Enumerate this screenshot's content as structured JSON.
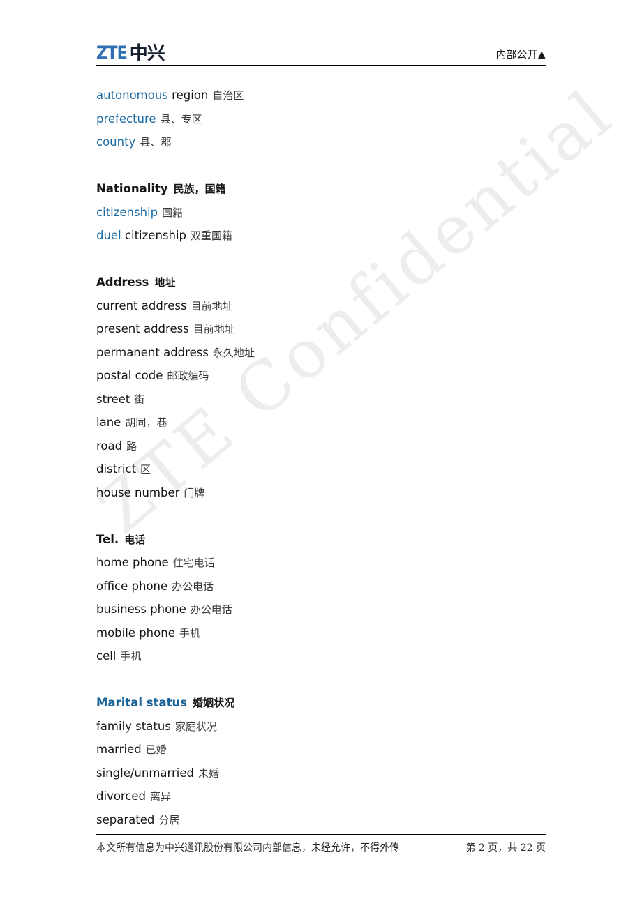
{
  "header": {
    "logo_en": "ZTE",
    "logo_cn": "中兴",
    "classification": "内部公开▲"
  },
  "watermark": {
    "text": "ZTE Confidential"
  },
  "content": {
    "blocks": [
      {
        "type": "entries",
        "items": [
          {
            "en_blue": "autonomous",
            "en_black": " region",
            "cn": "自治区"
          },
          {
            "en_blue": "prefecture",
            "en_black": "",
            "cn": "县、专区"
          },
          {
            "en_blue": "county",
            "en_black": "",
            "cn": "县、郡"
          }
        ]
      },
      {
        "type": "heading",
        "style": "black",
        "en": "Nationality",
        "cn": "民族，国籍"
      },
      {
        "type": "entries",
        "items": [
          {
            "en_blue": "citizenship",
            "en_black": "",
            "cn": "国籍"
          },
          {
            "en_blue": "duel",
            "en_black": " citizenship",
            "cn": "双重国籍"
          }
        ]
      },
      {
        "type": "heading",
        "style": "black",
        "en": "Address",
        "cn": "地址"
      },
      {
        "type": "entries",
        "items": [
          {
            "en_blue": "",
            "en_black": "current address",
            "cn": "目前地址"
          },
          {
            "en_blue": "",
            "en_black": "present address",
            "cn": "目前地址"
          },
          {
            "en_blue": "",
            "en_black": "permanent address",
            "cn": "永久地址"
          },
          {
            "en_blue": "",
            "en_black": "postal code",
            "cn": "邮政编码"
          },
          {
            "en_blue": "",
            "en_black": "street",
            "cn": "街"
          },
          {
            "en_blue": "",
            "en_black": "lane",
            "cn": "胡同，巷"
          },
          {
            "en_blue": "",
            "en_black": "road",
            "cn": "路"
          },
          {
            "en_blue": "",
            "en_black": "district",
            "cn": "区"
          },
          {
            "en_blue": "",
            "en_black": "house number",
            "cn": "门牌"
          }
        ]
      },
      {
        "type": "heading",
        "style": "black",
        "en": "Tel.",
        "cn": "电话"
      },
      {
        "type": "entries",
        "items": [
          {
            "en_blue": "",
            "en_black": "home phone",
            "cn": "住宅电话"
          },
          {
            "en_blue": "",
            "en_black": "office phone",
            "cn": "办公电话"
          },
          {
            "en_blue": "",
            "en_black": "business phone",
            "cn": "办公电话"
          },
          {
            "en_blue": "",
            "en_black": "mobile phone",
            "cn": "手机"
          },
          {
            "en_blue": "",
            "en_black": "cell",
            "cn": "手机"
          }
        ]
      },
      {
        "type": "heading",
        "style": "blue",
        "en": "Marital status",
        "cn": "婚姻状况"
      },
      {
        "type": "entries",
        "items": [
          {
            "en_blue": "",
            "en_black": "family status",
            "cn": "家庭状况"
          },
          {
            "en_blue": "",
            "en_black": "married",
            "cn": "已婚"
          },
          {
            "en_blue": "",
            "en_black": "single/unmarried",
            "cn": "未婚"
          },
          {
            "en_blue": "",
            "en_black": "divorced",
            "cn": "离异"
          },
          {
            "en_blue": "",
            "en_black": "separated",
            "cn": "分居"
          }
        ]
      }
    ]
  },
  "footer": {
    "notice": "本文所有信息为中兴通讯股份有限公司内部信息，未经允许，不得外传",
    "page": "第 2 页，共 22 页"
  },
  "colors": {
    "link_blue": "#1b6ba3",
    "heading_blue": "#1a6397",
    "logo_blue": "#2f6eb5",
    "logo_dark": "#16202e",
    "watermark_gray": "#ededed"
  }
}
